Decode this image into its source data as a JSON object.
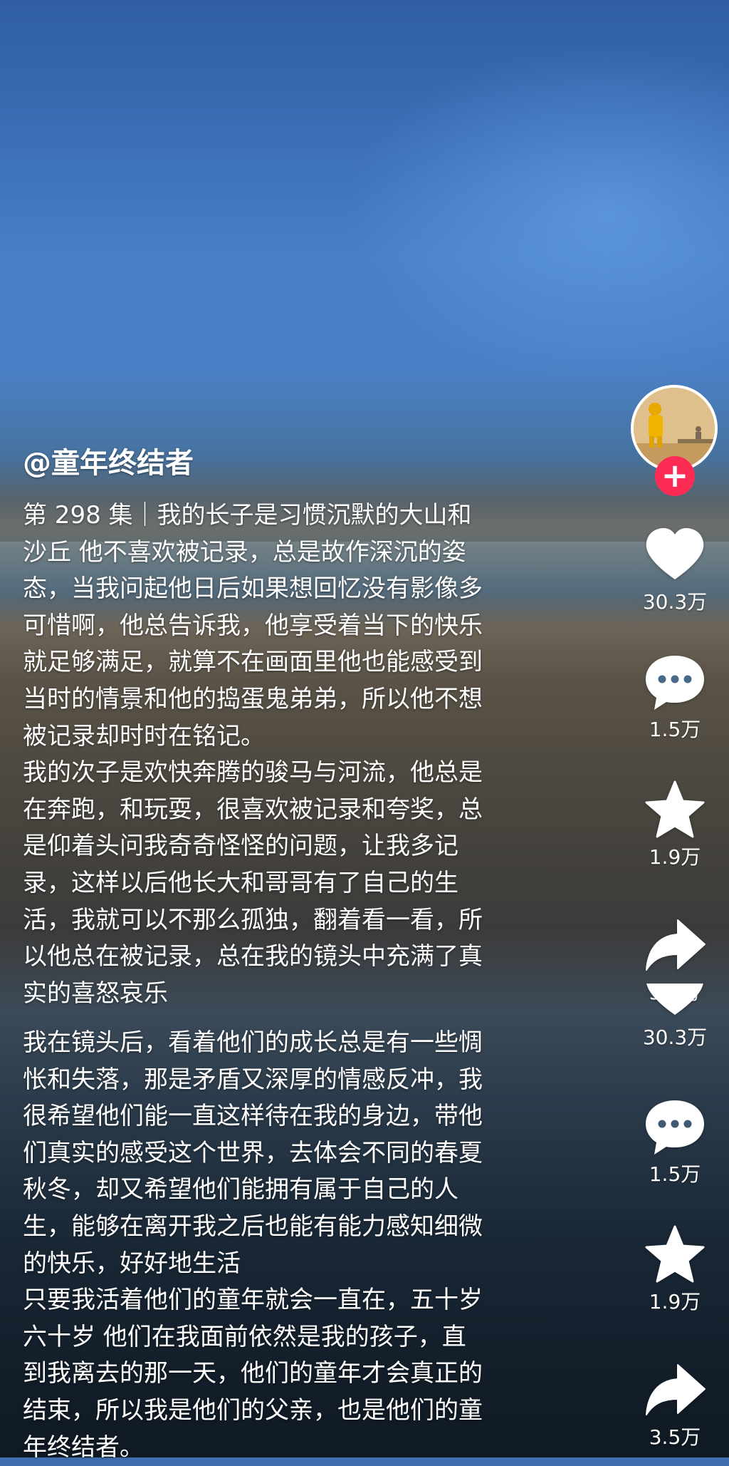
{
  "author": {
    "handle": "@童年终结者"
  },
  "caption_top": [
    "第 298 集｜我的长子是习惯沉默的大山和",
    "沙丘 他不喜欢被记录，总是故作深沉的姿",
    "态，当我问起他日后如果想回忆没有影像多",
    "可惜啊，他总告诉我，他享受着当下的快乐",
    "就足够满足，就算不在画面里他也能感受到",
    "当时的情景和他的捣蛋鬼弟弟，所以他不想",
    "被记录却时时在铭记。",
    "我的次子是欢快奔腾的骏马与河流，他总是",
    "在奔跑，和玩耍，很喜欢被记录和夸奖，总",
    "是仰着头问我奇奇怪怪的问题，让我多记",
    "录，这样以后他长大和哥哥有了自己的生",
    "活，我就可以不那么孤独，翻着看一看，所",
    "以他总在被记录，总在我的镜头中充满了真",
    "实的喜怒哀乐"
  ],
  "caption_bottom": [
    "我在镜头后，看着他们的成长总是有一些惆",
    "怅和失落，那是矛盾又深厚的情感反冲，我",
    "很希望他们能一直这样待在我的身边，带他",
    "们真实的感受这个世界，去体会不同的春夏",
    "秋冬，却又希望他们能拥有属于自己的人",
    "生，能够在离开我之后也能有能力感知细微",
    "的快乐，好好地生活",
    "只要我活着他们的童年就会一直在，五十岁",
    "六十岁 他们在我面前依然是我的孩子，直",
    "到我离去的那一天，他们的童年才会真正的",
    "结束，所以我是他们的父亲，也是他们的童",
    "年终结者。"
  ],
  "actions": {
    "follow_icon": "plus-icon",
    "like": {
      "icon": "heart-icon",
      "count": "30.3万"
    },
    "comment": {
      "icon": "comment-icon",
      "count": "1.5万"
    },
    "favorite": {
      "icon": "star-icon",
      "count": "1.9万"
    },
    "share": {
      "icon": "share-icon",
      "count": "3.5万"
    },
    "like_2": {
      "icon": "heart-icon",
      "count": "30.3万"
    },
    "comment_2": {
      "icon": "comment-icon",
      "count": "1.5万"
    },
    "favorite_2": {
      "icon": "star-icon",
      "count": "1.9万"
    },
    "share_2": {
      "icon": "share-icon",
      "count": "3.5万"
    }
  },
  "colors": {
    "follow_button": "#fe2c55",
    "text": "#ffffff"
  }
}
